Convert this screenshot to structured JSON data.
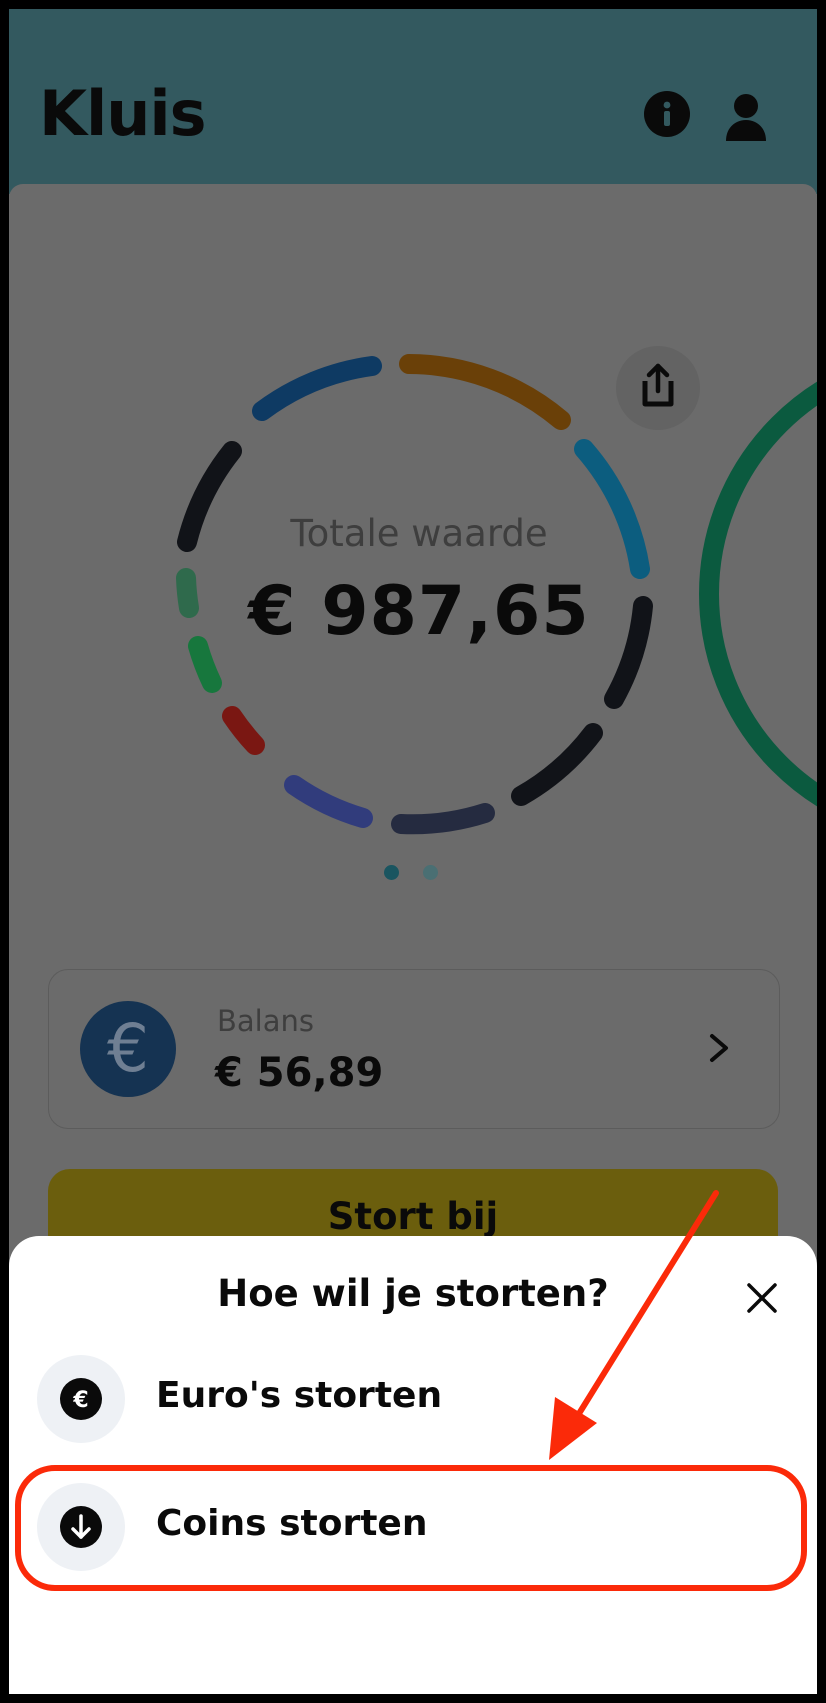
{
  "header": {
    "title": "Kluis",
    "info_icon": "info-icon",
    "profile_icon": "profile-icon",
    "background": "#33595f"
  },
  "portfolio": {
    "total_label": "Totale waarde",
    "total_value": "€ 987,65",
    "share_icon": "share-icon",
    "page_indicator": {
      "pages": 2,
      "active": 1
    },
    "ring_colors": [
      "#0e3a63",
      "#6a4008",
      "#0c5d7f",
      "#111318",
      "#111318",
      "#252b40",
      "#313c7c",
      "#7a1712",
      "#17773d",
      "#2f6a4c",
      "#111318"
    ]
  },
  "balance": {
    "label": "Balans",
    "value": "€ 56,89",
    "currency_icon": "euro-icon",
    "chevron_icon": "chevron-right-icon"
  },
  "deposit_button": {
    "label": "Stort bij",
    "color": "#6b5e0d"
  },
  "sheet": {
    "title": "Hoe wil je storten?",
    "close_icon": "close-icon",
    "options": [
      {
        "label": "Euro's storten",
        "icon": "euro-circle-icon"
      },
      {
        "label": "Coins storten",
        "icon": "arrow-down-circle-icon"
      }
    ]
  },
  "annotation": {
    "highlight_color": "#fb2a09",
    "highlighted_option": "Coins storten"
  }
}
